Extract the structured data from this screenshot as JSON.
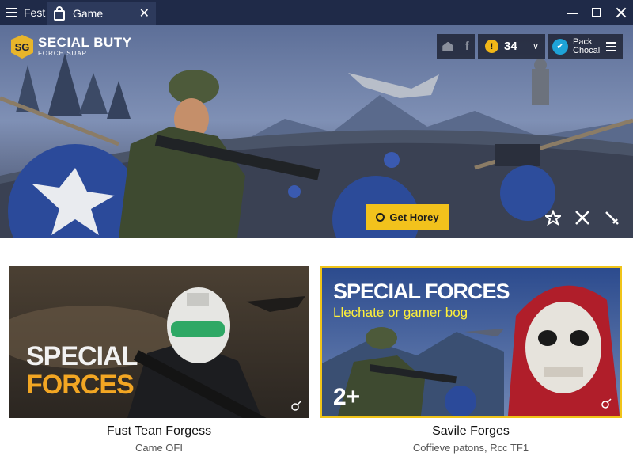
{
  "titlebar": {
    "app_label": "Fest",
    "tab_label": "Game"
  },
  "hero": {
    "logo_badge": "SG",
    "logo_title": "SECIAL BUTY",
    "logo_subtitle": "FORCE SUAP",
    "coins": "34",
    "account_line1": "Pack",
    "account_line2": "Chocal",
    "cta_label": "Get Horey"
  },
  "cards": [
    {
      "overlay_line1": "SPECIAL",
      "overlay_line2": "FORCES",
      "title": "Fust Tean Forgess",
      "subtitle": "Came OFI"
    },
    {
      "headline": "SPECIAL FORCES",
      "tagline": "Llechate or gamer bog",
      "age_badge": "2+",
      "title": "Savile Forges",
      "subtitle": "Coffieve patons, Rcc TF1"
    }
  ],
  "colors": {
    "titlebar": "#1f2a48",
    "accent_yellow": "#f2c21c",
    "card_border": "#f0c419",
    "coin": "#f1b718",
    "account_circle": "#1ea3d8"
  },
  "icons": [
    "menu-icon",
    "lock-icon",
    "close-icon",
    "minimize-icon",
    "maximize-icon",
    "home-icon",
    "facebook-icon",
    "coin-icon",
    "chevron-down-icon",
    "account-icon",
    "hamburger-icon",
    "star-icon",
    "crossed-swords-icon",
    "sword-icon",
    "grenade-icon"
  ]
}
